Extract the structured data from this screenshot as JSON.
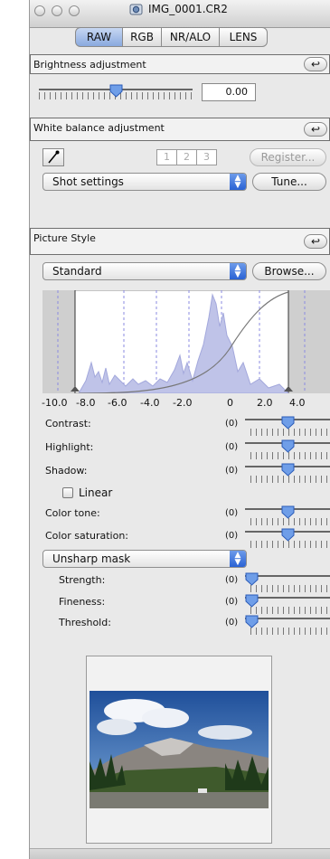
{
  "window": {
    "title": "IMG_0001.CR2",
    "title_icon": "camera-image-icon"
  },
  "tabs": [
    {
      "label": "RAW",
      "selected": true
    },
    {
      "label": "RGB",
      "selected": false
    },
    {
      "label": "NR/ALO",
      "selected": false
    },
    {
      "label": "LENS",
      "selected": false
    }
  ],
  "brightness": {
    "title": "Brightness adjustment",
    "value": "0.00",
    "reset_icon": "undo-icon"
  },
  "white_balance": {
    "title": "White balance adjustment",
    "eyedropper_icon": "eyedropper-icon",
    "presets": [
      "1",
      "2",
      "3"
    ],
    "register_label": "Register...",
    "select_value": "Shot settings",
    "tune_label": "Tune...",
    "reset_icon": "undo-icon"
  },
  "picture_style": {
    "title": "Picture Style",
    "select_value": "Standard",
    "browse_label": "Browse...",
    "reset_icon": "undo-icon"
  },
  "histogram": {
    "x_ticks": [
      "-10.0",
      "-8.0",
      "-6.0",
      "-4.0",
      "-2.0",
      "0",
      "2.0",
      "4.0"
    ]
  },
  "adjustments": [
    {
      "label": "Contrast:",
      "value": "(0)"
    },
    {
      "label": "Highlight:",
      "value": "(0)"
    },
    {
      "label": "Shadow:",
      "value": "(0)"
    },
    {
      "label": "Color tone:",
      "value": "(0)"
    },
    {
      "label": "Color saturation:",
      "value": "(0)"
    }
  ],
  "linear": {
    "label": "Linear",
    "checked": false
  },
  "unsharp": {
    "select_value": "Unsharp mask",
    "items": [
      {
        "label": "Strength:",
        "value": "(0)"
      },
      {
        "label": "Fineness:",
        "value": "(0)"
      },
      {
        "label": "Threshold:",
        "value": "(0)"
      }
    ]
  },
  "colors": {
    "accent": "#3a70d8",
    "window_bg": "#e9e9e9"
  }
}
